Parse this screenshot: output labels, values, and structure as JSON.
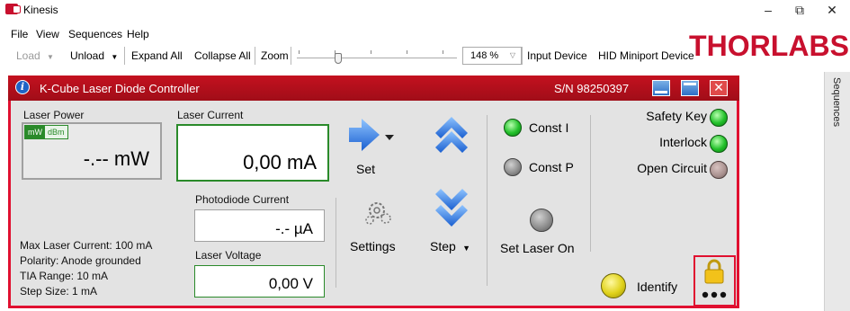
{
  "window": {
    "title": "Kinesis",
    "controls": [
      "–",
      "⧉",
      "✕"
    ]
  },
  "menu": [
    "File",
    "View",
    "Sequences",
    "Help"
  ],
  "toolbar": {
    "load": "Load",
    "unload": "Unload",
    "expand_all": "Expand All",
    "collapse_all": "Collapse All",
    "zoom_label": "Zoom",
    "zoom_value": "148 %",
    "input_device": "Input Device",
    "hid_device": "HID Miniport Device"
  },
  "brand": {
    "logo_text": "THORLABS",
    "color": "#c8102e"
  },
  "sequences_tab": "Sequences",
  "panel": {
    "title": "K-Cube Laser Diode Controller",
    "serial": "S/N 98250397",
    "accent": "#e01030",
    "laser_power": {
      "label": "Laser Power",
      "unit_mw": "mW",
      "unit_dbm": "dBm",
      "value": "-.-- mW"
    },
    "laser_current": {
      "label": "Laser Current",
      "value": "0,00 mA"
    },
    "photodiode_current": {
      "label": "Photodiode Current",
      "value": "-.- µA"
    },
    "laser_voltage": {
      "label": "Laser Voltage",
      "value": "0,00 V"
    },
    "info_lines": [
      "Max Laser Current: 100 mA",
      "Polarity: Anode grounded",
      "TIA Range: 10 mA",
      "Step Size: 1 mA"
    ],
    "buttons": {
      "set": "Set",
      "settings": "Settings",
      "step": "Step",
      "set_laser_on": "Set Laser On",
      "identify": "Identify"
    },
    "modes": {
      "const_i": "Const I",
      "const_p": "Const P"
    },
    "status": {
      "safety_key": "Safety Key",
      "interlock": "Interlock",
      "open_circuit": "Open Circuit"
    }
  }
}
